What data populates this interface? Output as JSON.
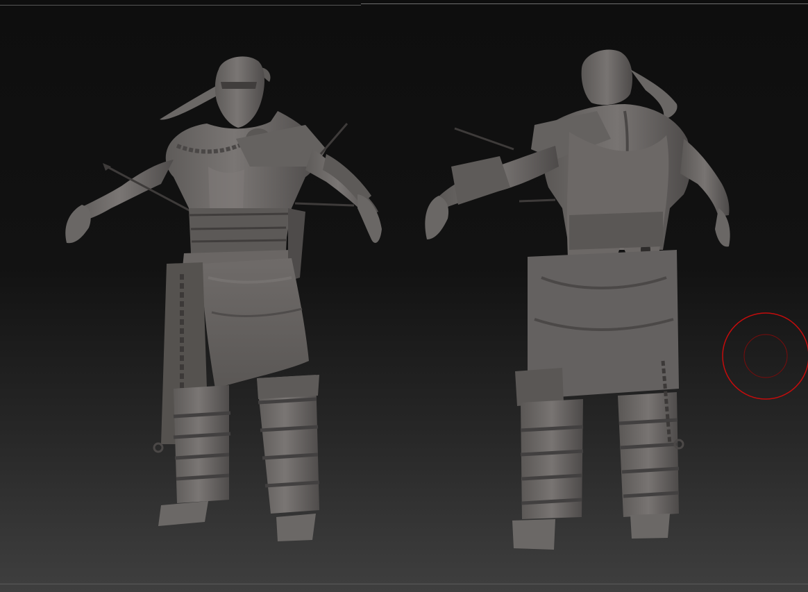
{
  "viewport": {
    "background_top": "#0e0e0e",
    "background_bottom": "#3f3f3f",
    "model_color": "#6e6b69",
    "model_shadow": "#3a3837",
    "model_highlight": "#8c8886",
    "brush_color": "#c40c0c"
  },
  "models": [
    {
      "view": "front",
      "icon": "sculpt-figure-front-icon"
    },
    {
      "view": "back",
      "icon": "sculpt-figure-back-icon"
    }
  ],
  "brush": {
    "icon": "brush-cursor-icon"
  }
}
